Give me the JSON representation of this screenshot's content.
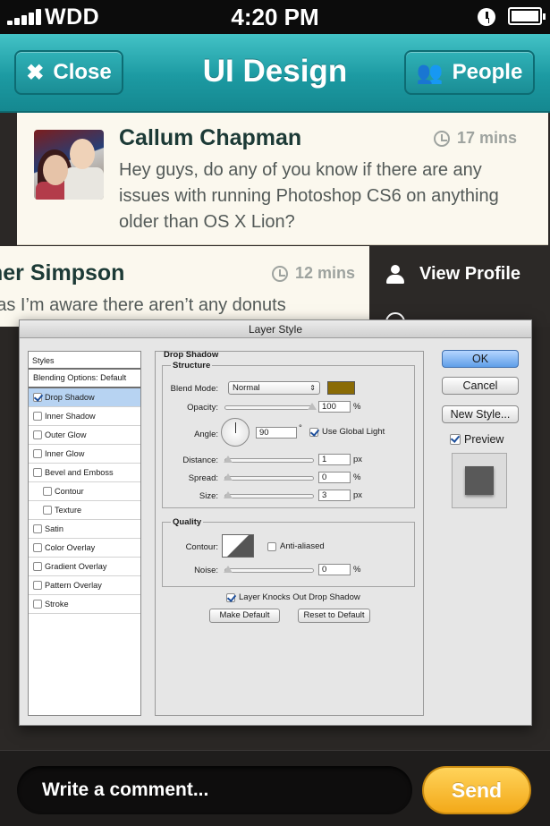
{
  "status": {
    "carrier": "WDD",
    "time": "4:20 PM"
  },
  "header": {
    "title": "UI Design",
    "close_label": "Close",
    "people_label": "People"
  },
  "posts": [
    {
      "name": "Callum Chapman",
      "time": "17 mins",
      "message": "Hey guys, do any of you know if there are any issues with running Photoshop CS6 on anything older than OS X Lion?"
    },
    {
      "name": "her Simpson",
      "time": "12 mins",
      "message": "r as I’m aware there aren’t any donuts"
    }
  ],
  "side_menu": {
    "view_profile": "View Profile"
  },
  "dialog": {
    "title": "Layer Style",
    "styles_header": "Styles",
    "blending_options": "Blending Options: Default",
    "style_items": [
      {
        "label": "Drop Shadow",
        "checked": true,
        "selected": true,
        "indent": false
      },
      {
        "label": "Inner Shadow",
        "checked": false,
        "selected": false,
        "indent": false
      },
      {
        "label": "Outer Glow",
        "checked": false,
        "selected": false,
        "indent": false
      },
      {
        "label": "Inner Glow",
        "checked": false,
        "selected": false,
        "indent": false
      },
      {
        "label": "Bevel and Emboss",
        "checked": false,
        "selected": false,
        "indent": false
      },
      {
        "label": "Contour",
        "checked": false,
        "selected": false,
        "indent": true
      },
      {
        "label": "Texture",
        "checked": false,
        "selected": false,
        "indent": true
      },
      {
        "label": "Satin",
        "checked": false,
        "selected": false,
        "indent": false
      },
      {
        "label": "Color Overlay",
        "checked": false,
        "selected": false,
        "indent": false
      },
      {
        "label": "Gradient Overlay",
        "checked": false,
        "selected": false,
        "indent": false
      },
      {
        "label": "Pattern Overlay",
        "checked": false,
        "selected": false,
        "indent": false
      },
      {
        "label": "Stroke",
        "checked": false,
        "selected": false,
        "indent": false
      }
    ],
    "section_title": "Drop Shadow",
    "structure_title": "Structure",
    "blend_mode_label": "Blend Mode:",
    "blend_mode_value": "Normal",
    "shadow_color": "#8a6b05",
    "opacity_label": "Opacity:",
    "opacity_value": "100",
    "angle_label": "Angle:",
    "angle_value": "90",
    "use_global_light_label": "Use Global Light",
    "distance_label": "Distance:",
    "distance_value": "1",
    "spread_label": "Spread:",
    "spread_value": "0",
    "size_label": "Size:",
    "size_value": "3",
    "unit_px": "px",
    "unit_pct": "%",
    "unit_deg": "°",
    "quality_title": "Quality",
    "contour_label": "Contour:",
    "anti_aliased_label": "Anti-aliased",
    "noise_label": "Noise:",
    "noise_value": "0",
    "knocks_out_label": "Layer Knocks Out Drop Shadow",
    "make_default_label": "Make Default",
    "reset_default_label": "Reset to Default",
    "ok_label": "OK",
    "cancel_label": "Cancel",
    "new_style_label": "New Style...",
    "preview_label": "Preview"
  },
  "comment": {
    "placeholder": "Write a comment...",
    "send_label": "Send"
  },
  "colors": {
    "accent": "#1c9aa2",
    "send": "#f3b21f",
    "shadow_swatch": "#8a6b05"
  }
}
